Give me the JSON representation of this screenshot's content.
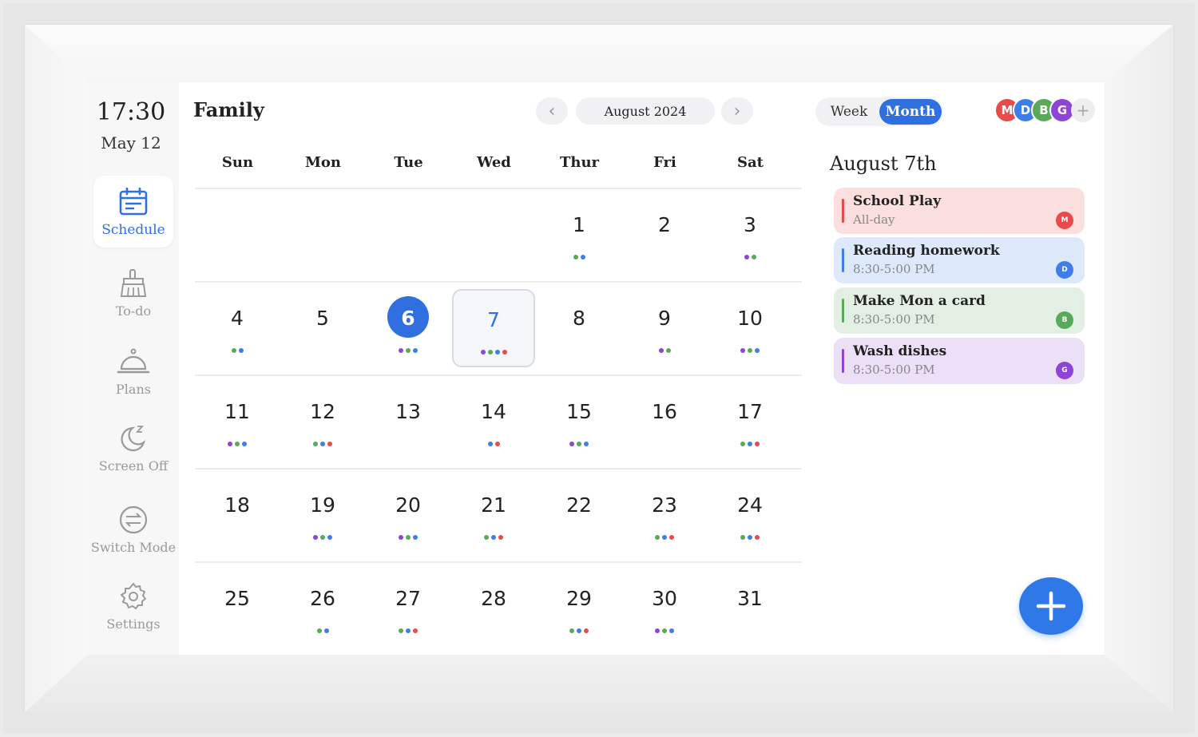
{
  "sidebar": {
    "time": "17:30",
    "date": "May 12",
    "items": [
      {
        "label": "Schedule",
        "icon": "calendar-icon"
      },
      {
        "label": "To-do",
        "icon": "broom-icon"
      },
      {
        "label": "Plans",
        "icon": "cloche-icon"
      },
      {
        "label": "Screen Off",
        "icon": "moon-icon"
      },
      {
        "label": "Switch Mode",
        "icon": "switch-arrows-icon"
      },
      {
        "label": "Settings",
        "icon": "gear-icon"
      }
    ]
  },
  "header": {
    "title": "Family",
    "month_label": "August 2024",
    "prev_icon": "chevron-left-icon",
    "next_icon": "chevron-right-icon",
    "view_week": "Week",
    "view_month": "Month",
    "avatars": [
      {
        "initial": "M",
        "color": "#e94b4b"
      },
      {
        "initial": "D",
        "color": "#3f7ee8"
      },
      {
        "initial": "B",
        "color": "#5aa85a"
      },
      {
        "initial": "G",
        "color": "#8e44d6"
      }
    ],
    "add_icon": "plus-icon"
  },
  "calendar": {
    "weekdays": [
      "Sun",
      "Mon",
      "Tue",
      "Wed",
      "Thur",
      "Fri",
      "Sat"
    ],
    "today": 6,
    "selected": 7,
    "weeks": [
      [
        null,
        null,
        null,
        null,
        {
          "n": "1",
          "dots": [
            "#5aa85a",
            "#3f7ee8"
          ]
        },
        {
          "n": "2",
          "dots": []
        },
        {
          "n": "3",
          "dots": [
            "#8e44d6",
            "#5aa85a"
          ]
        }
      ],
      [
        {
          "n": "4",
          "dots": [
            "#5aa85a",
            "#3f7ee8"
          ]
        },
        {
          "n": "5",
          "dots": []
        },
        {
          "n": "6",
          "dots": [
            "#8e44d6",
            "#5aa85a",
            "#3f7ee8"
          ]
        },
        {
          "n": "7",
          "dots": [
            "#8e44d6",
            "#5aa85a",
            "#3f7ee8",
            "#e94b4b"
          ]
        },
        {
          "n": "8",
          "dots": []
        },
        {
          "n": "9",
          "dots": [
            "#8e44d6",
            "#5aa85a"
          ]
        },
        {
          "n": "10",
          "dots": [
            "#8e44d6",
            "#5aa85a",
            "#3f7ee8"
          ]
        }
      ],
      [
        {
          "n": "11",
          "dots": [
            "#8e44d6",
            "#5aa85a",
            "#3f7ee8"
          ]
        },
        {
          "n": "12",
          "dots": [
            "#5aa85a",
            "#3f7ee8",
            "#e94b4b"
          ]
        },
        {
          "n": "13",
          "dots": []
        },
        {
          "n": "14",
          "dots": [
            "#3f7ee8",
            "#e94b4b"
          ]
        },
        {
          "n": "15",
          "dots": [
            "#8e44d6",
            "#5aa85a",
            "#3f7ee8"
          ]
        },
        {
          "n": "16",
          "dots": []
        },
        {
          "n": "17",
          "dots": [
            "#5aa85a",
            "#3f7ee8",
            "#e94b4b"
          ]
        }
      ],
      [
        {
          "n": "18",
          "dots": []
        },
        {
          "n": "19",
          "dots": [
            "#8e44d6",
            "#5aa85a",
            "#3f7ee8"
          ]
        },
        {
          "n": "20",
          "dots": [
            "#8e44d6",
            "#5aa85a",
            "#3f7ee8"
          ]
        },
        {
          "n": "21",
          "dots": [
            "#5aa85a",
            "#3f7ee8",
            "#e94b4b"
          ]
        },
        {
          "n": "22",
          "dots": []
        },
        {
          "n": "23",
          "dots": [
            "#5aa85a",
            "#3f7ee8",
            "#e94b4b"
          ]
        },
        {
          "n": "24",
          "dots": [
            "#5aa85a",
            "#3f7ee8",
            "#e94b4b"
          ]
        }
      ],
      [
        {
          "n": "25",
          "dots": []
        },
        {
          "n": "26",
          "dots": [
            "#5aa85a",
            "#3f7ee8"
          ]
        },
        {
          "n": "27",
          "dots": [
            "#5aa85a",
            "#3f7ee8",
            "#e94b4b"
          ]
        },
        {
          "n": "28",
          "dots": []
        },
        {
          "n": "29",
          "dots": [
            "#5aa85a",
            "#3f7ee8",
            "#e94b4b"
          ]
        },
        {
          "n": "30",
          "dots": [
            "#8e44d6",
            "#5aa85a",
            "#3f7ee8"
          ]
        },
        {
          "n": "31",
          "dots": []
        }
      ]
    ]
  },
  "panel": {
    "title": "August 7th",
    "events": [
      {
        "title": "School Play",
        "time": "All-day",
        "bg": "#fbdede",
        "bar": "#e94b4b",
        "avatar": "M",
        "avatar_color": "#e94b4b"
      },
      {
        "title": "Reading homework",
        "time": "8:30-5:00 PM",
        "bg": "#dde8fb",
        "bar": "#3f7ee8",
        "avatar": "D",
        "avatar_color": "#3f7ee8"
      },
      {
        "title": "Make Mon a card",
        "time": "8:30-5:00 PM",
        "bg": "#e3efe3",
        "bar": "#5aa85a",
        "avatar": "B",
        "avatar_color": "#5aa85a"
      },
      {
        "title": "Wash dishes",
        "time": "8:30-5:00 PM",
        "bg": "#ece0f8",
        "bar": "#8e44d6",
        "avatar": "G",
        "avatar_color": "#8e44d6"
      }
    ],
    "fab_icon": "plus-icon"
  },
  "colors": {
    "accent": "#2f6fe0",
    "member_m": "#e94b4b",
    "member_d": "#3f7ee8",
    "member_b": "#5aa85a",
    "member_g": "#8e44d6"
  }
}
